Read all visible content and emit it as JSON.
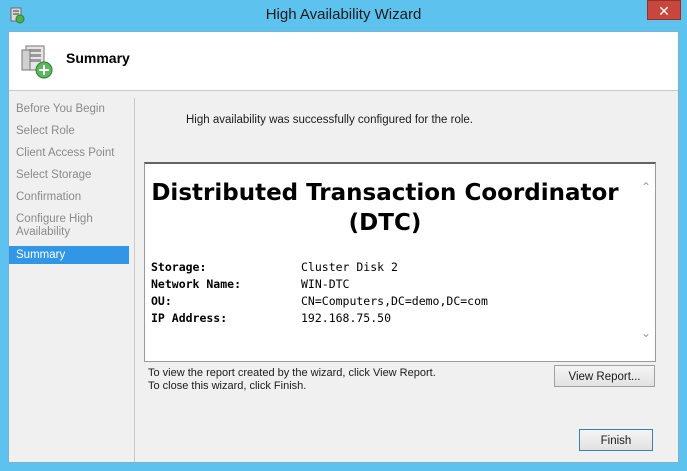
{
  "window": {
    "title": "High Availability Wizard",
    "close_glyph": "✕"
  },
  "header": {
    "title": "Summary",
    "icon": "wizard-server-icon"
  },
  "nav": {
    "items": [
      {
        "label": "Before You Begin"
      },
      {
        "label": "Select Role"
      },
      {
        "label": "Client Access Point"
      },
      {
        "label": "Select Storage"
      },
      {
        "label": "Confirmation"
      },
      {
        "label": "Configure High Availability"
      },
      {
        "label": "Summary",
        "active": true
      }
    ]
  },
  "main": {
    "status_message": "High availability was successfully configured for the role.",
    "report": {
      "title": "Distributed Transaction Coordinator (DTC)",
      "rows": [
        {
          "key": "Storage:",
          "value": "Cluster Disk 2"
        },
        {
          "key": "Network Name:",
          "value": "WIN-DTC"
        },
        {
          "key": "OU:",
          "value": "CN=Computers,DC=demo,DC=com"
        },
        {
          "key": "IP Address:",
          "value": "192.168.75.50"
        }
      ]
    },
    "hint_line1": "To view the report created by the wizard, click View Report.",
    "hint_line2": "To close this wizard, click Finish.",
    "view_report_label": "View Report...",
    "finish_label": "Finish"
  },
  "colors": {
    "titlebar": "#5ec2ef",
    "nav_active": "#3296e6",
    "close": "#c7463d"
  }
}
